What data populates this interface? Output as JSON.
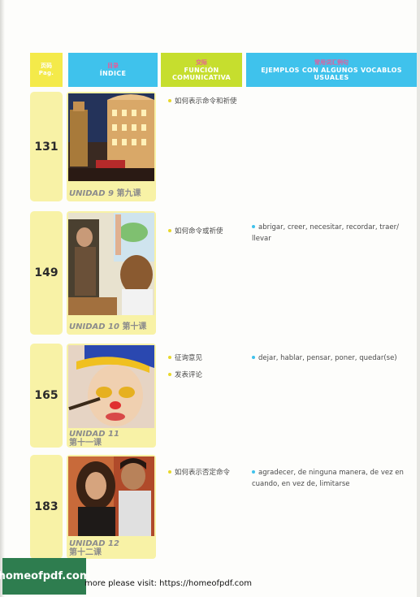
{
  "header": {
    "pag": {
      "zh": "页码",
      "es": "Pag."
    },
    "indice": {
      "zh": "目录",
      "es": "ÍNDICE"
    },
    "funcion": {
      "zh": "交际",
      "es": "FUNCIÓN COMUNICATIVA"
    },
    "ejemplos": {
      "zh": "常用词汇例句",
      "es": "EJEMPLOS CON ALGUNOS VOCABLOS USUALES"
    }
  },
  "rows": [
    {
      "page": "131",
      "unit_es": "UNIDAD 9",
      "unit_zh": "第九课",
      "photo": "city-building-night",
      "functions": [
        "如何表示命令和祈使"
      ],
      "examples": []
    },
    {
      "page": "149",
      "unit_es": "UNIDAD 10",
      "unit_zh": "第十课",
      "photo": "classroom-raised-hand",
      "functions": [
        "如何命令或祈使"
      ],
      "examples": [
        "abrigar, creer, necesitar, recordar, traer/ llevar"
      ]
    },
    {
      "page": "165",
      "unit_es": "UNIDAD 11",
      "unit_zh": "第十一课",
      "photo": "child-face-paint",
      "functions": [
        "征询意见",
        "发表评论"
      ],
      "examples": [
        "dejar, hablar, pensar, poner, quedar(se)"
      ]
    },
    {
      "page": "183",
      "unit_es": "UNIDAD 12",
      "unit_zh": "第十二课",
      "photo": "couple-surprised",
      "functions": [
        "如何表示否定命令"
      ],
      "examples": [
        "agradecer, de ninguna manera, de vez en cuando, en vez de, limitarse"
      ]
    }
  ],
  "watermark": {
    "logo": "homeofpdf.com",
    "text": "more please visit: https://homeofpdf.com"
  }
}
